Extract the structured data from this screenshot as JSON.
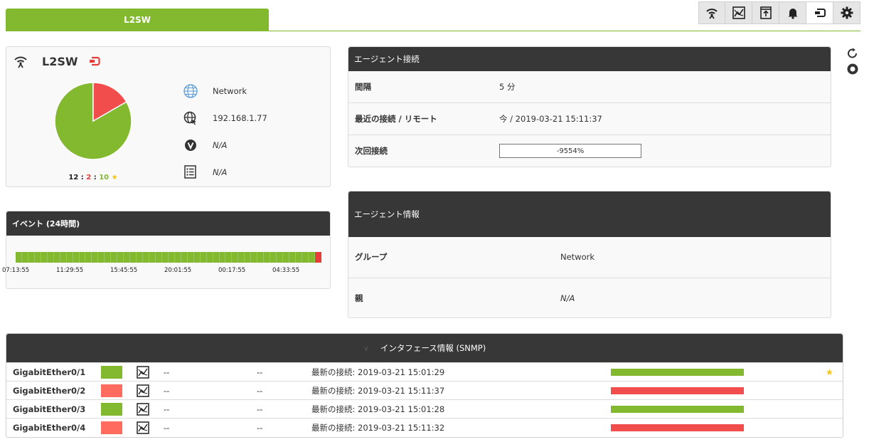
{
  "tab": {
    "label": "L2SW"
  },
  "toolbar": {
    "icons": [
      "wifi-tower-icon",
      "graph-icon",
      "upload-box-icon",
      "bell-icon",
      "agent-view-icon",
      "gear-icon"
    ]
  },
  "agent": {
    "name": "L2SW",
    "counts": {
      "total": "12",
      "critical": "2",
      "normal": "10",
      "sep": ":"
    },
    "pie": {
      "normal_fraction": 0.8333,
      "critical_fraction": 0.1667,
      "normal_color": "#82b92e",
      "critical_color": "#f24d4d"
    },
    "info": {
      "group": "Network",
      "ip": "192.168.1.77",
      "version": "N/A",
      "description": "N/A"
    }
  },
  "events": {
    "title": "イベント (24時間)",
    "times": [
      "07:13:55",
      "11:29:55",
      "15:45:55",
      "20:01:55",
      "00:17:55",
      "04:33:55"
    ]
  },
  "connection": {
    "title": "エージェント接続",
    "rows": [
      {
        "key": "間隔",
        "value": "5 分"
      },
      {
        "key": "最近の接続 / リモート",
        "value": "今 / 2019-03-21 15:11:37"
      },
      {
        "key": "次回接続",
        "value": "-9554%"
      }
    ]
  },
  "agent_info": {
    "title": "エージェント情報",
    "rows": [
      {
        "key": "グループ",
        "value": "Network"
      },
      {
        "key": "親",
        "value": "N/A"
      }
    ]
  },
  "interfaces": {
    "title": "インタフェース情報 (SNMP)",
    "rows": [
      {
        "name": "GigabitEther0/1",
        "status": "ok",
        "in": "--",
        "out": "--",
        "last": "最新の接続: 2019-03-21 15:01:29",
        "bar": "ok",
        "star": "★"
      },
      {
        "name": "GigabitEther0/2",
        "status": "critical",
        "in": "--",
        "out": "--",
        "last": "最新の接続: 2019-03-21 15:11:37",
        "bar": "critical",
        "star": ""
      },
      {
        "name": "GigabitEther0/3",
        "status": "ok",
        "in": "--",
        "out": "--",
        "last": "最新の接続: 2019-03-21 15:01:28",
        "bar": "ok",
        "star": ""
      },
      {
        "name": "GigabitEther0/4",
        "status": "critical",
        "in": "--",
        "out": "--",
        "last": "最新の接続: 2019-03-21 15:11:32",
        "bar": "critical",
        "star": ""
      }
    ],
    "colors": {
      "ok": "#82b92e",
      "critical": "#f24d4d",
      "ok_status": "#82b92e",
      "critical_status": "#ff6b5e"
    }
  }
}
